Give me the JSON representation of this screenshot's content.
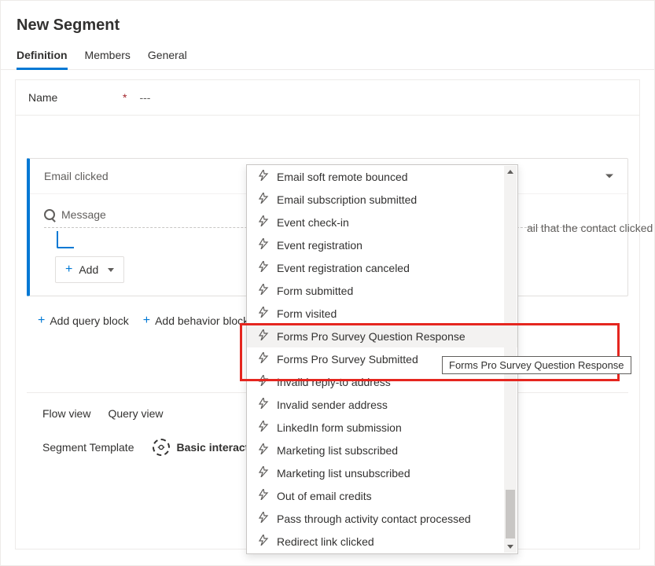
{
  "header": {
    "title": "New Segment"
  },
  "tabs": [
    {
      "label": "Definition",
      "active": true
    },
    {
      "label": "Members",
      "active": false
    },
    {
      "label": "General",
      "active": false
    }
  ],
  "nameField": {
    "label": "Name",
    "required": "*",
    "value": "---"
  },
  "queryBlock": {
    "selected": "Email clicked",
    "lookup": {
      "placeholder": "Message"
    },
    "hint": "ail that the contact clicked on",
    "addButton": "Add"
  },
  "blockActions": {
    "addQuery": "Add query block",
    "addBehavior": "Add behavior block"
  },
  "footer": {
    "flowView": "Flow view",
    "queryView": "Query view",
    "segmentTemplateLabel": "Segment Template",
    "segmentTemplateValue": "Basic interaction"
  },
  "dropdown": {
    "items": [
      "Email soft remote bounced",
      "Email subscription submitted",
      "Event check-in",
      "Event registration",
      "Event registration canceled",
      "Form submitted",
      "Form visited",
      "Forms Pro Survey Question Response",
      "Forms Pro Survey Submitted",
      "Invalid reply-to address",
      "Invalid sender address",
      "LinkedIn form submission",
      "Marketing list subscribed",
      "Marketing list unsubscribed",
      "Out of email credits",
      "Pass through activity contact processed",
      "Redirect link clicked"
    ],
    "hoveredIndex": 7
  },
  "tooltip": "Forms Pro Survey Question Response"
}
